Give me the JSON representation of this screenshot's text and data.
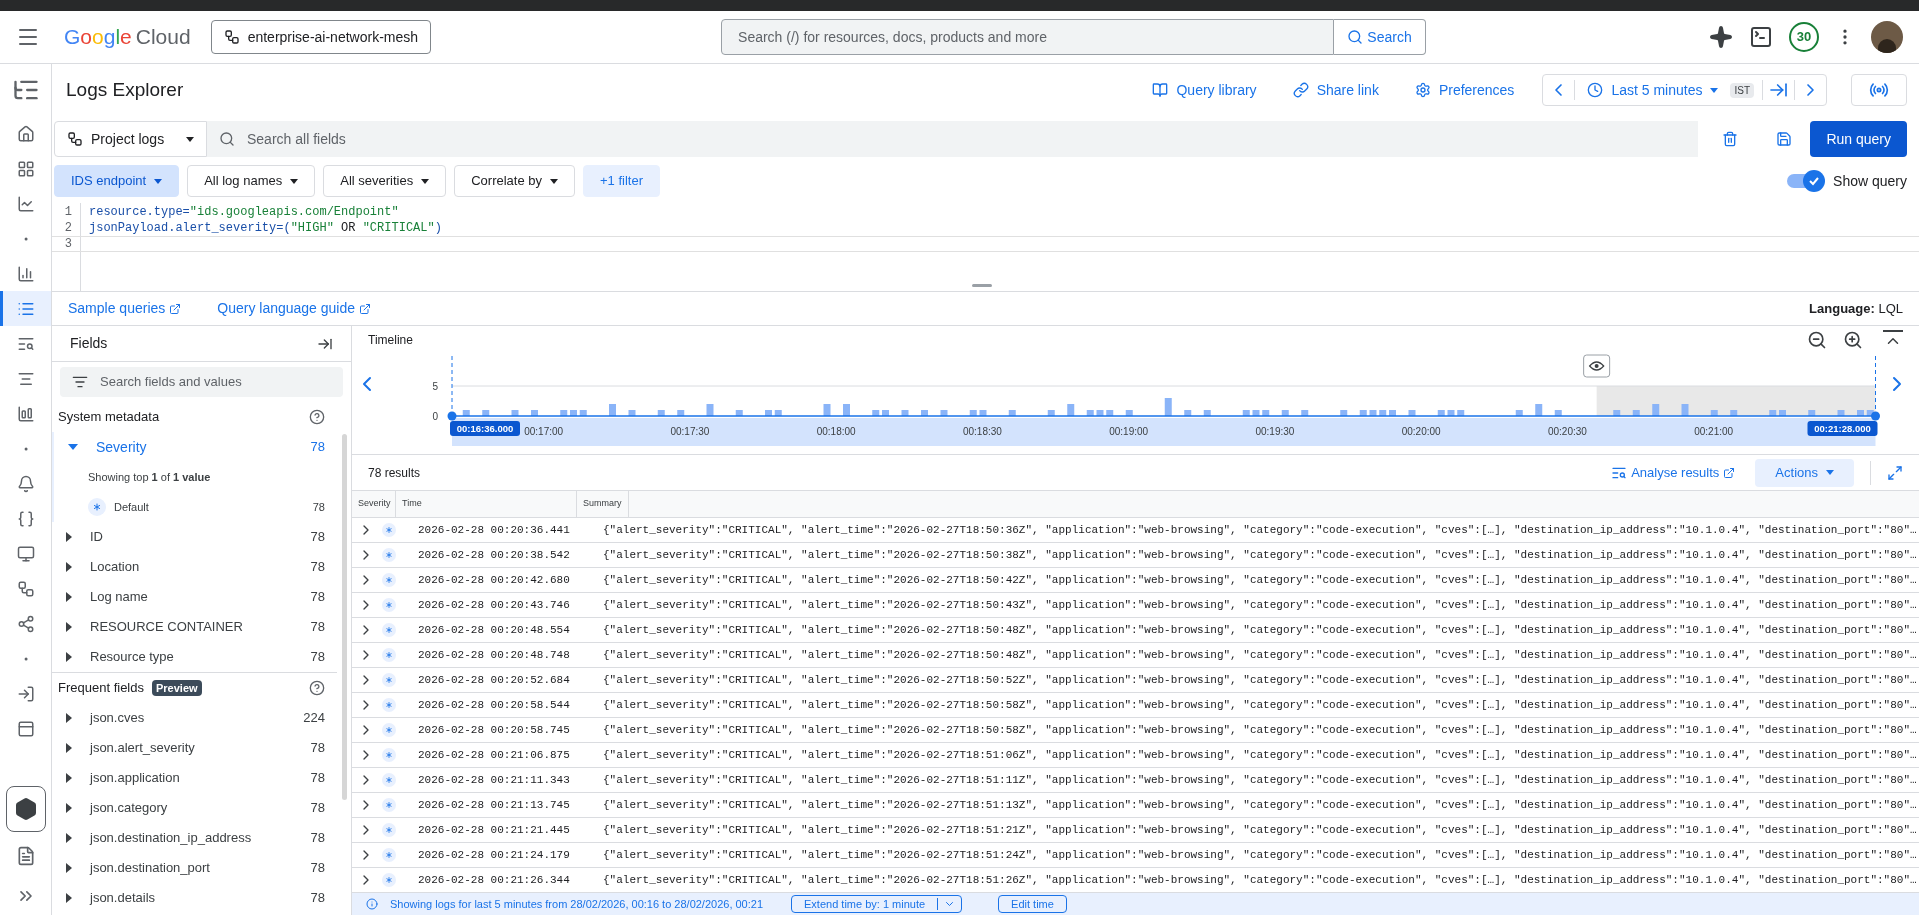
{
  "header": {
    "logo": {
      "brand": "Google",
      "product": "Cloud"
    },
    "project": "enterprise-ai-network-mesh",
    "search": {
      "placeholder": "Search (/) for resources, docs, products and more",
      "button": "Search"
    },
    "notifications": "30"
  },
  "rail_items": [
    {
      "selected": false
    },
    {
      "selected": false
    },
    {
      "selected": false
    },
    {
      "selected": false
    },
    {
      "selected": false
    },
    {
      "selected": true
    },
    {
      "selected": false
    },
    {
      "selected": false
    },
    {
      "selected": false
    },
    {
      "selected": false
    },
    {
      "selected": false
    },
    {
      "selected": false
    },
    {
      "selected": false
    },
    {
      "selected": false
    },
    {
      "selected": false
    },
    {
      "selected": false
    },
    {
      "selected": false
    },
    {
      "selected": false
    }
  ],
  "page": {
    "title": "Logs Explorer",
    "actions": [
      "Query library",
      "Share link",
      "Preferences"
    ],
    "time_range": "Last 5 minutes",
    "timezone": "IST"
  },
  "query_bar": {
    "scope": "Project logs",
    "search_placeholder": "Search all fields",
    "run_button": "Run query"
  },
  "filters": [
    {
      "label": "IDS endpoint",
      "selected": true,
      "kind": "dropdown"
    },
    {
      "label": "All log names",
      "selected": false,
      "kind": "dropdown"
    },
    {
      "label": "All severities",
      "selected": false,
      "kind": "dropdown"
    },
    {
      "label": "Correlate by",
      "selected": false,
      "kind": "dropdown"
    },
    {
      "label": "+1 filter",
      "selected": false,
      "kind": "more"
    }
  ],
  "show_query": {
    "label": "Show query",
    "on": true
  },
  "editor": {
    "lines": [
      {
        "number": "1",
        "current": false,
        "tokens": [
          {
            "text": "resource.type=",
            "kind": "field"
          },
          {
            "text": "\"ids.googleapis.com/Endpoint\"",
            "kind": "string"
          }
        ]
      },
      {
        "number": "2",
        "current": false,
        "tokens": [
          {
            "text": "jsonPayload.alert_severity=(",
            "kind": "field"
          },
          {
            "text": "\"HIGH\"",
            "kind": "string"
          },
          {
            "text": " OR ",
            "kind": "keyword"
          },
          {
            "text": "\"CRITICAL\"",
            "kind": "string"
          },
          {
            "text": ")",
            "kind": "field"
          }
        ]
      },
      {
        "number": "3",
        "current": true
      }
    ]
  },
  "links": [
    "Sample queries",
    "Query language guide"
  ],
  "language": "**Language:** LQL",
  "fields_panel": {
    "title": "Fields",
    "search_placeholder": "Search fields and values",
    "sections": [
      {
        "title": "System metadata",
        "items": [
          {
            "name": "Severity",
            "count": "78",
            "expanded": true,
            "summary": "Showing top **1** of **1 value**",
            "values": [
              {
                "name": "Default",
                "count": "78"
              }
            ]
          },
          {
            "name": "ID",
            "count": "78",
            "expanded": false
          },
          {
            "name": "Location",
            "count": "78",
            "expanded": false
          },
          {
            "name": "Log name",
            "count": "78",
            "expanded": false
          },
          {
            "name": "RESOURCE CONTAINER",
            "count": "78",
            "expanded": false
          },
          {
            "name": "Resource type",
            "count": "78",
            "expanded": false
          }
        ]
      },
      {
        "title": "Frequent fields",
        "badge": "Preview",
        "items": [
          {
            "name": "json.cves",
            "count": "224",
            "expanded": false
          },
          {
            "name": "json.alert_severity",
            "count": "78",
            "expanded": false
          },
          {
            "name": "json.application",
            "count": "78",
            "expanded": false
          },
          {
            "name": "json.category",
            "count": "78",
            "expanded": false
          },
          {
            "name": "json.destination_ip_address",
            "count": "78",
            "expanded": false
          },
          {
            "name": "json.destination_port",
            "count": "78",
            "expanded": false
          },
          {
            "name": "json.details",
            "count": "78",
            "expanded": false
          }
        ]
      }
    ]
  },
  "timeline": {
    "title": "Timeline",
    "start_label": "00:16:36.000",
    "end_label": "00:21:28.000",
    "chart_data": {
      "type": "bar",
      "ylim": [
        0,
        10
      ],
      "yticks": [
        0,
        5
      ],
      "categories": [
        null,
        null,
        null,
        null,
        null,
        null,
        null,
        null,
        null,
        "00:17:00",
        null,
        null,
        null,
        null,
        null,
        null,
        null,
        null,
        null,
        null,
        null,
        null,
        null,
        null,
        "00:17:30",
        null,
        null,
        null,
        null,
        null,
        null,
        null,
        null,
        null,
        null,
        null,
        null,
        null,
        null,
        "00:18:00",
        null,
        null,
        null,
        null,
        null,
        null,
        null,
        null,
        null,
        null,
        null,
        null,
        null,
        null,
        "00:18:30",
        null,
        null,
        null,
        null,
        null,
        null,
        null,
        null,
        null,
        null,
        null,
        null,
        null,
        null,
        "00:19:00",
        null,
        null,
        null,
        null,
        null,
        null,
        null,
        null,
        null,
        null,
        null,
        null,
        null,
        null,
        "00:19:30",
        null,
        null,
        null,
        null,
        null,
        null,
        null,
        null,
        null,
        null,
        null,
        null,
        null,
        null,
        "00:20:00",
        null,
        null,
        null,
        null,
        null,
        null,
        null,
        null,
        null,
        null,
        null,
        null,
        null,
        null,
        "00:20:30",
        null,
        null,
        null,
        null,
        null,
        null,
        null,
        null,
        null,
        null,
        null,
        null,
        null,
        null,
        "00:21:00",
        null,
        null,
        null,
        null,
        null,
        null,
        null,
        null,
        null,
        null,
        null,
        null,
        null,
        null,
        null,
        null
      ],
      "series": [
        {
          "color": "#8ab4f8",
          "values": [
            0,
            1,
            0,
            1,
            0,
            0,
            1,
            0,
            1,
            0,
            0,
            1,
            1,
            1,
            0,
            0,
            2,
            0,
            1,
            0,
            0,
            1,
            0,
            1,
            0,
            0,
            2,
            0,
            0,
            1,
            0,
            0,
            1,
            1,
            0,
            0,
            0,
            0,
            2,
            0,
            2,
            0,
            0,
            1,
            1,
            0,
            1,
            0,
            1,
            0,
            1,
            0,
            0,
            1,
            1,
            0,
            0,
            1,
            0,
            0,
            0,
            1,
            0,
            2,
            0,
            1,
            1,
            1,
            0,
            1,
            0,
            0,
            0,
            3,
            0,
            1,
            0,
            1,
            0,
            0,
            0,
            1,
            1,
            1,
            0,
            1,
            0,
            1,
            0,
            0,
            0,
            1,
            0,
            1,
            1,
            1,
            1,
            0,
            1,
            0,
            0,
            1,
            1,
            1,
            0,
            0,
            0,
            0,
            0,
            1,
            0,
            2,
            0,
            1,
            0,
            0,
            0,
            0,
            0,
            1,
            0,
            1,
            0,
            2,
            0,
            0,
            2,
            0,
            0,
            1,
            0,
            1,
            0,
            0,
            0,
            1,
            1,
            0,
            0,
            1,
            0,
            0,
            1,
            0,
            1,
            1
          ]
        }
      ]
    }
  },
  "results": {
    "count": "78 results",
    "analyse": "Analyse results",
    "actions": "Actions",
    "columns": [
      "Severity",
      "Time",
      "Summary"
    ],
    "rows": [
      {
        "time": "2026-02-28 00:20:36.441",
        "summary": "{\"alert_severity\":\"CRITICAL\", \"alert_time\":\"2026-02-27T18:50:36Z\", \"application\":\"web-browsing\", \"category\":\"code-execution\", \"cves\":[…], \"destination_ip_address\":\"10.1.0.4\", \"destination_port\":\"80\"…"
      },
      {
        "time": "2026-02-28 00:20:38.542",
        "summary": "{\"alert_severity\":\"CRITICAL\", \"alert_time\":\"2026-02-27T18:50:38Z\", \"application\":\"web-browsing\", \"category\":\"code-execution\", \"cves\":[…], \"destination_ip_address\":\"10.1.0.4\", \"destination_port\":\"80\"…"
      },
      {
        "time": "2026-02-28 00:20:42.680",
        "summary": "{\"alert_severity\":\"CRITICAL\", \"alert_time\":\"2026-02-27T18:50:42Z\", \"application\":\"web-browsing\", \"category\":\"code-execution\", \"cves\":[…], \"destination_ip_address\":\"10.1.0.4\", \"destination_port\":\"80\"…"
      },
      {
        "time": "2026-02-28 00:20:43.746",
        "summary": "{\"alert_severity\":\"CRITICAL\", \"alert_time\":\"2026-02-27T18:50:43Z\", \"application\":\"web-browsing\", \"category\":\"code-execution\", \"cves\":[…], \"destination_ip_address\":\"10.1.0.4\", \"destination_port\":\"80\"…"
      },
      {
        "time": "2026-02-28 00:20:48.554",
        "summary": "{\"alert_severity\":\"CRITICAL\", \"alert_time\":\"2026-02-27T18:50:48Z\", \"application\":\"web-browsing\", \"category\":\"code-execution\", \"cves\":[…], \"destination_ip_address\":\"10.1.0.4\", \"destination_port\":\"80\"…"
      },
      {
        "time": "2026-02-28 00:20:48.748",
        "summary": "{\"alert_severity\":\"CRITICAL\", \"alert_time\":\"2026-02-27T18:50:48Z\", \"application\":\"web-browsing\", \"category\":\"code-execution\", \"cves\":[…], \"destination_ip_address\":\"10.1.0.4\", \"destination_port\":\"80\"…"
      },
      {
        "time": "2026-02-28 00:20:52.684",
        "summary": "{\"alert_severity\":\"CRITICAL\", \"alert_time\":\"2026-02-27T18:50:52Z\", \"application\":\"web-browsing\", \"category\":\"code-execution\", \"cves\":[…], \"destination_ip_address\":\"10.1.0.4\", \"destination_port\":\"80\"…"
      },
      {
        "time": "2026-02-28 00:20:58.544",
        "summary": "{\"alert_severity\":\"CRITICAL\", \"alert_time\":\"2026-02-27T18:50:58Z\", \"application\":\"web-browsing\", \"category\":\"code-execution\", \"cves\":[…], \"destination_ip_address\":\"10.1.0.4\", \"destination_port\":\"80\"…"
      },
      {
        "time": "2026-02-28 00:20:58.745",
        "summary": "{\"alert_severity\":\"CRITICAL\", \"alert_time\":\"2026-02-27T18:50:58Z\", \"application\":\"web-browsing\", \"category\":\"code-execution\", \"cves\":[…], \"destination_ip_address\":\"10.1.0.4\", \"destination_port\":\"80\"…"
      },
      {
        "time": "2026-02-28 00:21:06.875",
        "summary": "{\"alert_severity\":\"CRITICAL\", \"alert_time\":\"2026-02-27T18:51:06Z\", \"application\":\"web-browsing\", \"category\":\"code-execution\", \"cves\":[…], \"destination_ip_address\":\"10.1.0.4\", \"destination_port\":\"80\"…"
      },
      {
        "time": "2026-02-28 00:21:11.343",
        "summary": "{\"alert_severity\":\"CRITICAL\", \"alert_time\":\"2026-02-27T18:51:11Z\", \"application\":\"web-browsing\", \"category\":\"code-execution\", \"cves\":[…], \"destination_ip_address\":\"10.1.0.4\", \"destination_port\":\"80\"…"
      },
      {
        "time": "2026-02-28 00:21:13.745",
        "summary": "{\"alert_severity\":\"CRITICAL\", \"alert_time\":\"2026-02-27T18:51:13Z\", \"application\":\"web-browsing\", \"category\":\"code-execution\", \"cves\":[…], \"destination_ip_address\":\"10.1.0.4\", \"destination_port\":\"80\"…"
      },
      {
        "time": "2026-02-28 00:21:21.445",
        "summary": "{\"alert_severity\":\"CRITICAL\", \"alert_time\":\"2026-02-27T18:51:21Z\", \"application\":\"web-browsing\", \"category\":\"code-execution\", \"cves\":[…], \"destination_ip_address\":\"10.1.0.4\", \"destination_port\":\"80\"…"
      },
      {
        "time": "2026-02-28 00:21:24.179",
        "summary": "{\"alert_severity\":\"CRITICAL\", \"alert_time\":\"2026-02-27T18:51:24Z\", \"application\":\"web-browsing\", \"category\":\"code-execution\", \"cves\":[…], \"destination_ip_address\":\"10.1.0.4\", \"destination_port\":\"80\"…"
      },
      {
        "time": "2026-02-28 00:21:26.344",
        "summary": "{\"alert_severity\":\"CRITICAL\", \"alert_time\":\"2026-02-27T18:51:26Z\", \"application\":\"web-browsing\", \"category\":\"code-execution\", \"cves\":[…], \"destination_ip_address\":\"10.1.0.4\", \"destination_port\":\"80\"…"
      }
    ]
  },
  "footer": {
    "message": "Showing logs for last 5 minutes from 28/02/2026, 00:16 to 28/02/2026, 00:21",
    "extend_button": "Extend time by: 1 minute",
    "edit_button": "Edit time"
  }
}
